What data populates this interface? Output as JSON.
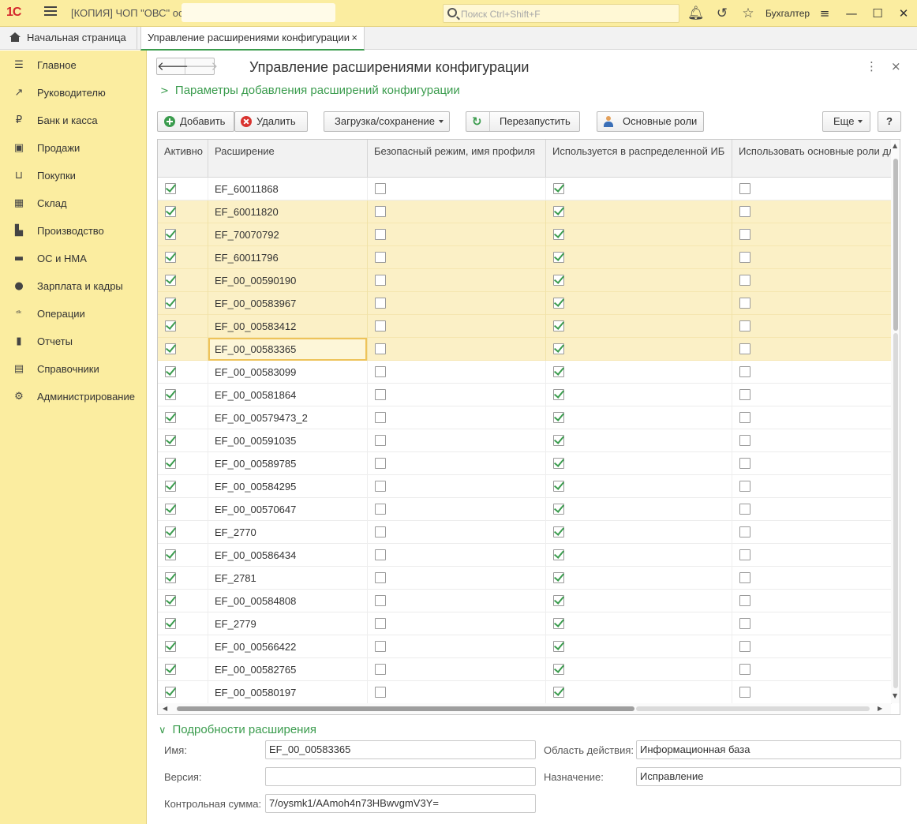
{
  "titlebar": {
    "logo": "1С",
    "title": "[КОПИЯ] ЧОП \"ОВС\" основная",
    "search_placeholder": "Поиск Ctrl+Shift+F",
    "user": "Бухгалтер"
  },
  "tabs": {
    "home": "Начальная страница",
    "active": "Управление расширениями конфигурации",
    "close_glyph": "×"
  },
  "sidebar": {
    "items": [
      {
        "label": "Главное",
        "icon": "menu-icon",
        "glyph": "☰"
      },
      {
        "label": "Руководителю",
        "icon": "trend-icon",
        "glyph": "↗"
      },
      {
        "label": "Банк и касса",
        "icon": "coin-icon",
        "glyph": "₽"
      },
      {
        "label": "Продажи",
        "icon": "bag-icon",
        "glyph": "▣"
      },
      {
        "label": "Покупки",
        "icon": "cart-icon",
        "glyph": "⊔"
      },
      {
        "label": "Склад",
        "icon": "warehouse-icon",
        "glyph": "▦"
      },
      {
        "label": "Производство",
        "icon": "factory-icon",
        "glyph": "▙"
      },
      {
        "label": "ОС и НМА",
        "icon": "truck-icon",
        "glyph": "▬"
      },
      {
        "label": "Зарплата и кадры",
        "icon": "person-icon",
        "glyph": "●"
      },
      {
        "label": "Операции",
        "icon": "dt-kt-icon",
        "glyph": "ᵈᵏ"
      },
      {
        "label": "Отчеты",
        "icon": "bar-chart-icon",
        "glyph": "▮"
      },
      {
        "label": "Справочники",
        "icon": "book-icon",
        "glyph": "▤"
      },
      {
        "label": "Администрирование",
        "icon": "gear-icon",
        "glyph": "⚙"
      }
    ]
  },
  "page": {
    "title": "Управление расширениями конфигурации",
    "params_group": "Параметры добавления расширений конфигурации",
    "details_group": "Подробности расширения"
  },
  "toolbar": {
    "add": "Добавить",
    "delete": "Удалить",
    "load_save": "Загрузка/сохранение",
    "restart": "Перезапустить",
    "main_roles": "Основные роли",
    "more": "Еще",
    "help": "?"
  },
  "table": {
    "columns": [
      "Активно",
      "Расширение",
      "Безопасный режим, имя профиля",
      "Используется в распределенной ИБ",
      "Использовать основные роли для"
    ],
    "rows": [
      {
        "active": true,
        "name": "EF_60011868",
        "safe": false,
        "distributed": true,
        "roles": false,
        "highlight": false
      },
      {
        "active": true,
        "name": "EF_60011820",
        "safe": false,
        "distributed": true,
        "roles": false,
        "highlight": true
      },
      {
        "active": true,
        "name": "EF_70070792",
        "safe": false,
        "distributed": true,
        "roles": false,
        "highlight": true
      },
      {
        "active": true,
        "name": "EF_60011796",
        "safe": false,
        "distributed": true,
        "roles": false,
        "highlight": true
      },
      {
        "active": true,
        "name": "EF_00_00590190",
        "safe": false,
        "distributed": true,
        "roles": false,
        "highlight": true
      },
      {
        "active": true,
        "name": "EF_00_00583967",
        "safe": false,
        "distributed": true,
        "roles": false,
        "highlight": true
      },
      {
        "active": true,
        "name": "EF_00_00583412",
        "safe": false,
        "distributed": true,
        "roles": false,
        "highlight": true
      },
      {
        "active": true,
        "name": "EF_00_00583365",
        "safe": false,
        "distributed": true,
        "roles": false,
        "highlight": true,
        "selected": true
      },
      {
        "active": true,
        "name": "EF_00_00583099",
        "safe": false,
        "distributed": true,
        "roles": false,
        "highlight": false
      },
      {
        "active": true,
        "name": "EF_00_00581864",
        "safe": false,
        "distributed": true,
        "roles": false,
        "highlight": false
      },
      {
        "active": true,
        "name": "EF_00_00579473_2",
        "safe": false,
        "distributed": true,
        "roles": false,
        "highlight": false
      },
      {
        "active": true,
        "name": "EF_00_00591035",
        "safe": false,
        "distributed": true,
        "roles": false,
        "highlight": false
      },
      {
        "active": true,
        "name": "EF_00_00589785",
        "safe": false,
        "distributed": true,
        "roles": false,
        "highlight": false
      },
      {
        "active": true,
        "name": "EF_00_00584295",
        "safe": false,
        "distributed": true,
        "roles": false,
        "highlight": false
      },
      {
        "active": true,
        "name": "EF_00_00570647",
        "safe": false,
        "distributed": true,
        "roles": false,
        "highlight": false
      },
      {
        "active": true,
        "name": "EF_2770",
        "safe": false,
        "distributed": true,
        "roles": false,
        "highlight": false
      },
      {
        "active": true,
        "name": "EF_00_00586434",
        "safe": false,
        "distributed": true,
        "roles": false,
        "highlight": false
      },
      {
        "active": true,
        "name": "EF_2781",
        "safe": false,
        "distributed": true,
        "roles": false,
        "highlight": false
      },
      {
        "active": true,
        "name": "EF_00_00584808",
        "safe": false,
        "distributed": true,
        "roles": false,
        "highlight": false
      },
      {
        "active": true,
        "name": "EF_2779",
        "safe": false,
        "distributed": true,
        "roles": false,
        "highlight": false
      },
      {
        "active": true,
        "name": "EF_00_00566422",
        "safe": false,
        "distributed": true,
        "roles": false,
        "highlight": false
      },
      {
        "active": true,
        "name": "EF_00_00582765",
        "safe": false,
        "distributed": true,
        "roles": false,
        "highlight": false
      },
      {
        "active": true,
        "name": "EF_00_00580197",
        "safe": false,
        "distributed": true,
        "roles": false,
        "highlight": false
      }
    ]
  },
  "details": {
    "name_label": "Имя:",
    "name_value": "EF_00_00583365",
    "version_label": "Версия:",
    "version_value": "",
    "checksum_label": "Контрольная сумма:",
    "checksum_value": "7/oysmk1/AAmoh4n73HBwvgmV3Y=",
    "scope_label": "Область действия:",
    "scope_value": "Информационная база",
    "purpose_label": "Назначение:",
    "purpose_value": "Исправление"
  },
  "colors": {
    "accent_green": "#3b9c4e",
    "panel_yellow": "#fbeda0",
    "row_highlight": "#fbf0c6"
  }
}
